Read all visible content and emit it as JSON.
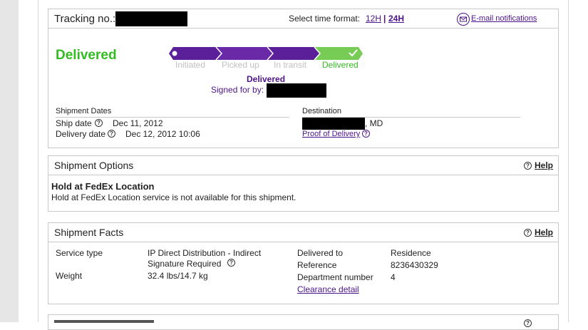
{
  "tracking": {
    "label": "Tracking no.:",
    "time_format_label": "Select time format:",
    "time_12h": "12H",
    "time_sep": "|",
    "time_24h": "24H",
    "email_link": "E-mail notifications"
  },
  "status": {
    "headline": "Delivered",
    "steps": [
      "Initiated",
      "Picked up",
      "In transit",
      "Delivered"
    ],
    "current_step": 4,
    "detail_status": "Delivered",
    "signed_for_label": "Signed for by:"
  },
  "shipment_dates": {
    "heading": "Shipment Dates",
    "ship_label": "Ship date",
    "ship_value": "Dec 11, 2012",
    "delivery_label": "Delivery date",
    "delivery_value": "Dec 12, 2012 10:06"
  },
  "destination": {
    "heading": "Destination",
    "state_suffix": ", MD",
    "proof_link": "Proof of Delivery"
  },
  "options": {
    "title": "Shipment Options",
    "help": "Help",
    "item_title": "Hold at FedEx Location",
    "item_text": "Hold at FedEx Location service is not available for this shipment."
  },
  "facts": {
    "title": "Shipment Facts",
    "help": "Help",
    "service_label": "Service type",
    "service_value_line1": "IP Direct Distribution - Indirect",
    "service_value_line2": "Signature Required",
    "weight_label": "Weight",
    "weight_value": "32.4 lbs/14.7 kg",
    "delivered_to_label": "Delivered to",
    "delivered_to_value": "Residence",
    "reference_label": "Reference",
    "reference_value": "8236430329",
    "department_label": "Department number",
    "department_value": "4",
    "clearance_link": "Clearance detail"
  },
  "colors": {
    "purple": "#4d148c",
    "green": "#33bb22",
    "grey_step": "#c8c8c8"
  }
}
